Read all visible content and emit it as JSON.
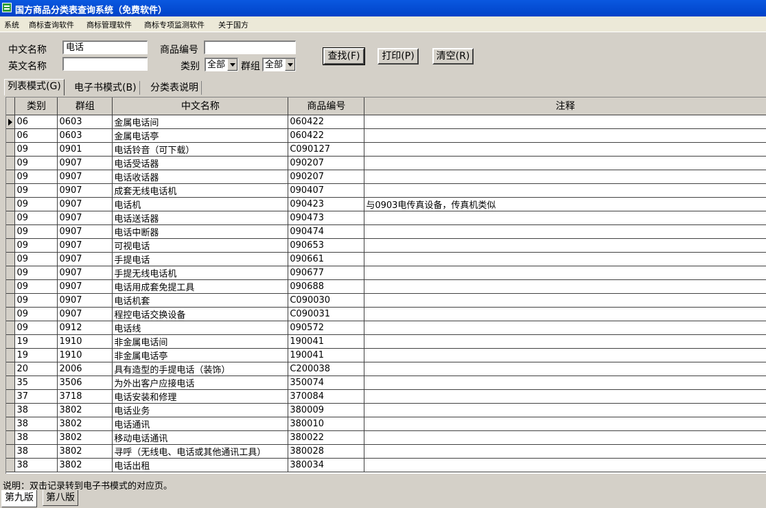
{
  "window": {
    "title": "国方商品分类表查询系统（免费软件）"
  },
  "menu": [
    "系统",
    "商标查询软件",
    "商标管理软件",
    "商标专项监测软件",
    "关于国方"
  ],
  "form": {
    "cn_name_label": "中文名称",
    "cn_name_value": "电话",
    "en_name_label": "英文名称",
    "en_name_value": "",
    "code_label": "商品编号",
    "code_value": "",
    "class_label": "类别",
    "class_value": "全部",
    "group_label": "群组",
    "group_value": "全部",
    "search_label": "查找(F)",
    "print_label": "打印(P)",
    "clear_label": "清空(R)"
  },
  "tabs": [
    "列表模式(G)",
    "电子书模式(B)",
    "分类表说明"
  ],
  "table": {
    "headers": [
      "类别",
      "群组",
      "中文名称",
      "商品编号",
      "注释"
    ],
    "rows": [
      [
        "06",
        "0603",
        "金属电话间",
        "060422",
        ""
      ],
      [
        "06",
        "0603",
        "金属电话亭",
        "060422",
        ""
      ],
      [
        "09",
        "0901",
        "电话铃音（可下载）",
        "C090127",
        ""
      ],
      [
        "09",
        "0907",
        "电话受话器",
        "090207",
        ""
      ],
      [
        "09",
        "0907",
        "电话收话器",
        "090207",
        ""
      ],
      [
        "09",
        "0907",
        "成套无线电话机",
        "090407",
        ""
      ],
      [
        "09",
        "0907",
        "电话机",
        "090423",
        "与0903电传真设备，传真机类似"
      ],
      [
        "09",
        "0907",
        "电话送话器",
        "090473",
        ""
      ],
      [
        "09",
        "0907",
        "电话中断器",
        "090474",
        ""
      ],
      [
        "09",
        "0907",
        "可视电话",
        "090653",
        ""
      ],
      [
        "09",
        "0907",
        "手提电话",
        "090661",
        ""
      ],
      [
        "09",
        "0907",
        "手提无线电话机",
        "090677",
        ""
      ],
      [
        "09",
        "0907",
        "电话用成套免提工具",
        "090688",
        ""
      ],
      [
        "09",
        "0907",
        "电话机套",
        "C090030",
        ""
      ],
      [
        "09",
        "0907",
        "程控电话交换设备",
        "C090031",
        ""
      ],
      [
        "09",
        "0912",
        "电话线",
        "090572",
        ""
      ],
      [
        "19",
        "1910",
        "非金属电话间",
        "190041",
        ""
      ],
      [
        "19",
        "1910",
        "非金属电话亭",
        "190041",
        ""
      ],
      [
        "20",
        "2006",
        "具有造型的手提电话（装饰）",
        "C200038",
        ""
      ],
      [
        "35",
        "3506",
        "为外出客户应接电话",
        "350074",
        ""
      ],
      [
        "37",
        "3718",
        "电话安装和修理",
        "370084",
        ""
      ],
      [
        "38",
        "3802",
        "电话业务",
        "380009",
        ""
      ],
      [
        "38",
        "3802",
        "电话通讯",
        "380010",
        ""
      ],
      [
        "38",
        "3802",
        "移动电话通讯",
        "380022",
        ""
      ],
      [
        "38",
        "3802",
        "寻呼（无线电、电话或其他通讯工具）",
        "380028",
        ""
      ],
      [
        "38",
        "3802",
        "电话出租",
        "380034",
        ""
      ]
    ]
  },
  "status": "说明：双击记录转到电子书模式的对应页。",
  "edition_tabs": [
    "第九版",
    "第八版"
  ]
}
